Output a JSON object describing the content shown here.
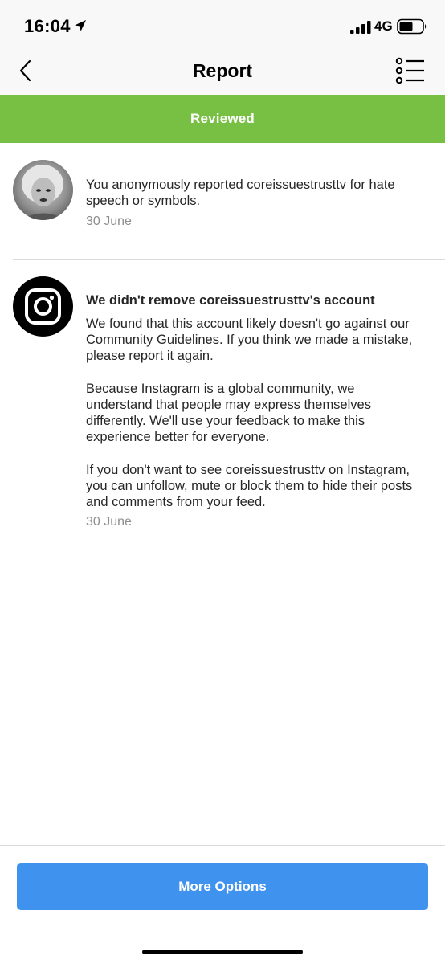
{
  "status_bar": {
    "time": "16:04",
    "network": "4G",
    "location_icon": "location-arrow-icon",
    "signal_icon": "cellular-signal-icon",
    "battery_icon": "battery-icon"
  },
  "nav": {
    "title": "Report",
    "back_icon": "chevron-left-icon",
    "menu_icon": "list-options-icon"
  },
  "banner": {
    "label": "Reviewed",
    "color": "#78c043"
  },
  "report_item": {
    "text_line1": "You anonymously reported coreissuestrusttv for hate",
    "text_line2": "speech or symbols.",
    "date": "30 June"
  },
  "decision_item": {
    "icon": "instagram-logo-icon",
    "title": "We didn't remove coreissuestrusttv's account",
    "para1": [
      "We found that this account likely doesn't go against our",
      "Community Guidelines. If you think we made a mistake,",
      "please report it again."
    ],
    "para2": [
      "Because Instagram is a global community, we",
      "understand that people may express themselves",
      "differently. We'll use your feedback to make this",
      "experience better for everyone."
    ],
    "para3": [
      "If you don't want to see coreissuestrusttv on Instagram,",
      "you can unfollow, mute or block them to hide their posts",
      "and comments from your feed."
    ],
    "date": "30 June"
  },
  "footer": {
    "button_label": "More Options",
    "button_color": "#3f92ee"
  }
}
